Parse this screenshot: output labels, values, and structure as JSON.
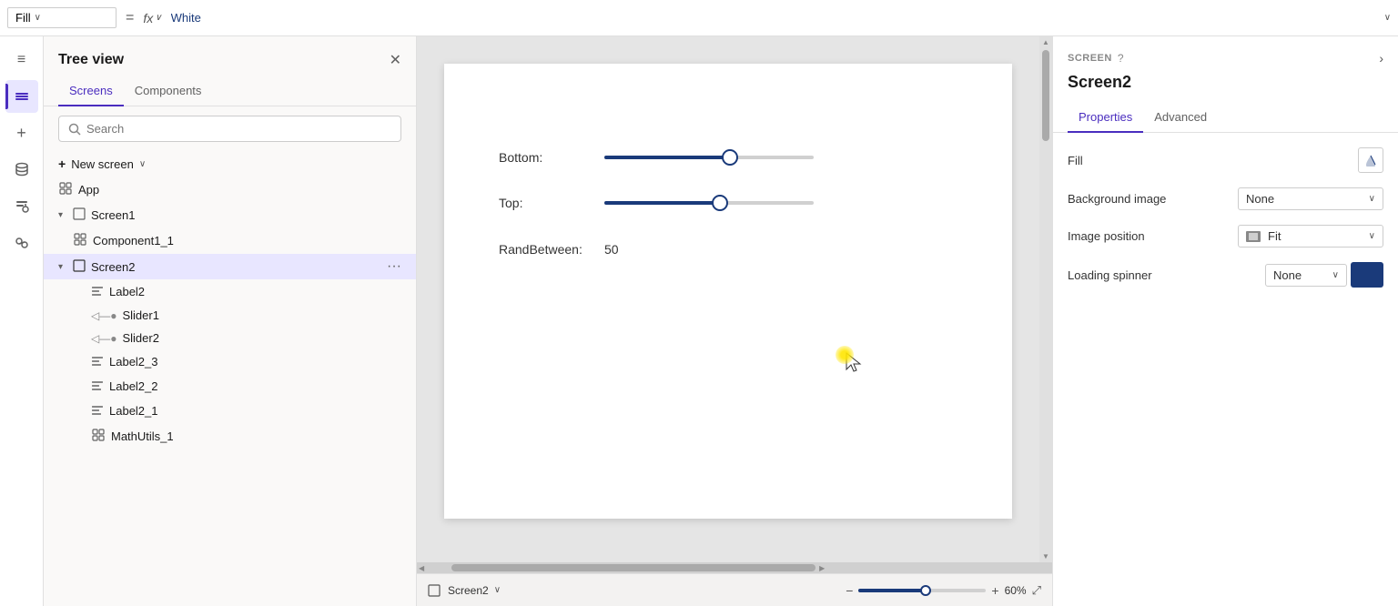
{
  "formulaBar": {
    "property": "Fill",
    "eq": "=",
    "fx": "fx",
    "chevron": "∨",
    "value": "White",
    "expandChevron": "∨"
  },
  "iconRail": {
    "items": [
      {
        "name": "hamburger-menu",
        "icon": "≡",
        "active": false
      },
      {
        "name": "layers",
        "icon": "⧉",
        "active": true
      },
      {
        "name": "add",
        "icon": "+",
        "active": false
      },
      {
        "name": "cylinder",
        "icon": "⬤",
        "active": false
      },
      {
        "name": "music",
        "icon": "♪",
        "active": false
      },
      {
        "name": "tools",
        "icon": "⚙",
        "active": false
      }
    ]
  },
  "treeView": {
    "title": "Tree view",
    "tabs": [
      "Screens",
      "Components"
    ],
    "activeTab": "Screens",
    "searchPlaceholder": "Search",
    "newScreen": "New screen",
    "items": [
      {
        "id": "app",
        "label": "App",
        "icon": "▦",
        "indent": 0,
        "type": "app"
      },
      {
        "id": "screen1",
        "label": "Screen1",
        "icon": "▢",
        "indent": 0,
        "type": "screen",
        "expanded": true
      },
      {
        "id": "component1_1",
        "label": "Component1_1",
        "icon": "▦",
        "indent": 1,
        "type": "component"
      },
      {
        "id": "screen2",
        "label": "Screen2",
        "icon": "▢",
        "indent": 0,
        "type": "screen",
        "expanded": true,
        "selected": true
      },
      {
        "id": "label2",
        "label": "Label2",
        "icon": "✎",
        "indent": 2,
        "type": "label"
      },
      {
        "id": "slider1",
        "label": "Slider1",
        "icon": "◁",
        "indent": 2,
        "type": "slider"
      },
      {
        "id": "slider2",
        "label": "Slider2",
        "icon": "◁",
        "indent": 2,
        "type": "slider"
      },
      {
        "id": "label2_3",
        "label": "Label2_3",
        "icon": "✎",
        "indent": 2,
        "type": "label"
      },
      {
        "id": "label2_2",
        "label": "Label2_2",
        "icon": "✎",
        "indent": 2,
        "type": "label"
      },
      {
        "id": "label2_1",
        "label": "Label2_1",
        "icon": "✎",
        "indent": 2,
        "type": "label"
      },
      {
        "id": "mathutils_1",
        "label": "MathUtils_1",
        "icon": "▦",
        "indent": 2,
        "type": "component"
      }
    ]
  },
  "canvas": {
    "widgets": {
      "bottomSlider": {
        "label": "Bottom:",
        "fillWidth": 60,
        "thumbLeft": 56
      },
      "topSlider": {
        "label": "Top:",
        "fillWidth": 55,
        "thumbLeft": 51
      },
      "randBetween": {
        "label": "RandBetween:",
        "value": "50"
      }
    },
    "screenName": "Screen2",
    "zoom": "60",
    "zoomUnit": "%",
    "zoomFillWidth": 70
  },
  "propsPanel": {
    "screenLabel": "SCREEN",
    "helpIcon": "?",
    "screenName": "Screen2",
    "expandIcon": ">",
    "tabs": [
      "Properties",
      "Advanced"
    ],
    "activeTab": "Properties",
    "rows": [
      {
        "id": "fill",
        "label": "Fill",
        "type": "fill"
      },
      {
        "id": "backgroundImage",
        "label": "Background image",
        "type": "select",
        "value": "None"
      },
      {
        "id": "imagePosition",
        "label": "Image position",
        "type": "select",
        "value": "Fit",
        "hasIcon": true
      },
      {
        "id": "loadingSpinner",
        "label": "Loading spinner",
        "type": "loadingspinner",
        "value": "None"
      }
    ]
  }
}
